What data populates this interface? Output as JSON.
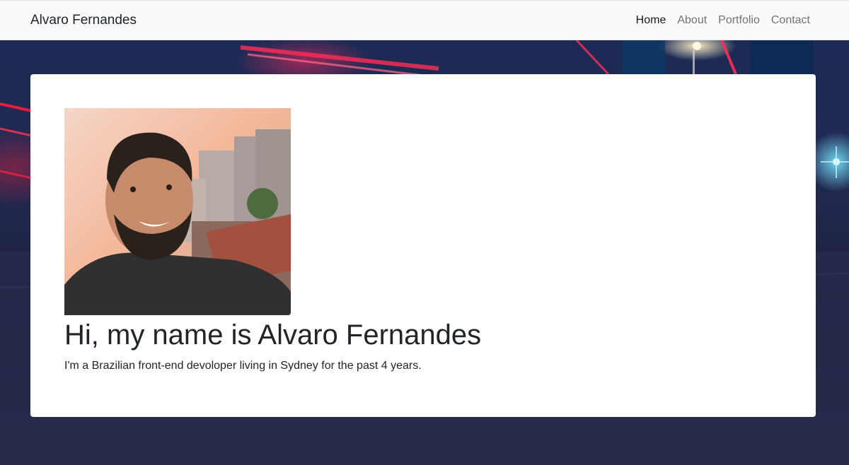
{
  "navbar": {
    "brand": "Alvaro Fernandes",
    "links": [
      {
        "label": "Home",
        "active": true
      },
      {
        "label": "About",
        "active": false
      },
      {
        "label": "Portfolio",
        "active": false
      },
      {
        "label": "Contact",
        "active": false
      }
    ]
  },
  "hero": {
    "photo_alt": "Alvaro Fernandes selfie",
    "heading": "Hi, my name is Alvaro Fernandes",
    "description": "I'm a Brazilian front-end devoloper living in Sydney for the past 4 years."
  },
  "colors": {
    "navbar_bg": "#f8f9fa",
    "card_bg": "#ffffff",
    "text": "#212529",
    "nav_inactive": "rgba(0,0,0,0.55)",
    "page_bg": "#1d2140"
  }
}
